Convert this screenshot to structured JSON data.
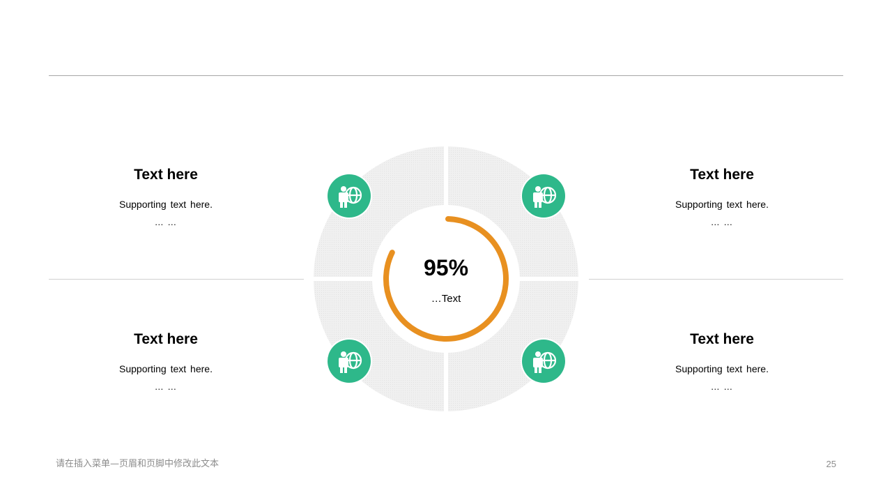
{
  "blocks": [
    {
      "title": "Text here",
      "text": "Supporting  text here.",
      "ellipsis": "… …"
    },
    {
      "title": "Text here",
      "text": "Supporting  text here.",
      "ellipsis": "… …"
    },
    {
      "title": "Text here",
      "text": "Supporting  text here.",
      "ellipsis": "… …"
    },
    {
      "title": "Text here",
      "text": "Supporting  text here.",
      "ellipsis": "… …"
    }
  ],
  "center": {
    "value": "95%",
    "label": "…Text",
    "progress_percent": 95
  },
  "icons": {
    "semantic": "person-globe-icon",
    "count": 4
  },
  "colors": {
    "accent_orange": "#e89020",
    "icon_green": "#2eb88a",
    "ring_gray": "#eeeeee",
    "rule_gray": "#bfbfbf"
  },
  "footer": {
    "text": "请在插入菜单—页眉和页脚中修改此文本",
    "page_number": "25"
  }
}
